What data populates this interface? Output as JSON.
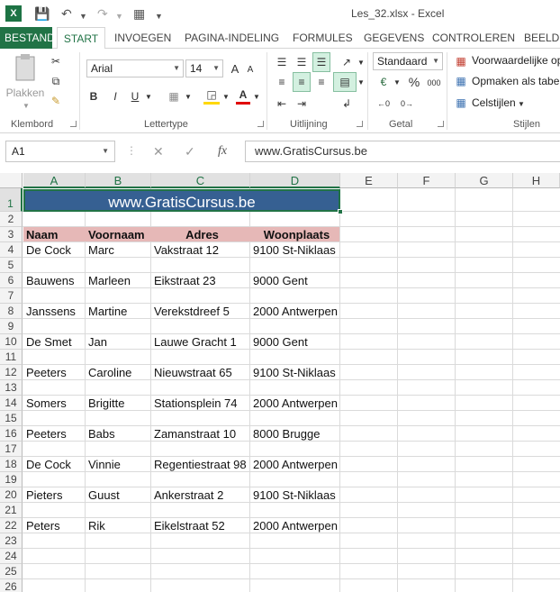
{
  "window": {
    "title": "Les_32.xlsx - Excel"
  },
  "tabs": [
    "BESTAND",
    "START",
    "INVOEGEN",
    "PAGINA-INDELING",
    "FORMULES",
    "GEGEVENS",
    "CONTROLEREN",
    "BEELD"
  ],
  "ribbon": {
    "clipboard": {
      "paste_label": "Plakken",
      "group": "Klembord"
    },
    "font": {
      "name": "Arial",
      "size": "14",
      "group": "Lettertype",
      "bold": "B",
      "italic": "I",
      "underline": "U",
      "grow": "A",
      "shrink": "A"
    },
    "alignment": {
      "group": "Uitlijning"
    },
    "number": {
      "format": "Standaard",
      "group": "Getal",
      "percent": "%",
      "thousands": "000"
    },
    "styles": {
      "conditional": "Voorwaardelijke op",
      "table": "Opmaken als tabel",
      "cell_styles": "Celstijlen",
      "group": "Stijlen"
    }
  },
  "formula_bar": {
    "name_box": "A1",
    "fx": "fx",
    "content": "www.GratisCursus.be"
  },
  "columns": [
    "A",
    "B",
    "C",
    "D",
    "E",
    "F",
    "G",
    "H"
  ],
  "rows": [
    "1",
    "2",
    "3",
    "4",
    "5",
    "6",
    "7",
    "8",
    "9",
    "10",
    "11",
    "12",
    "13",
    "14",
    "15",
    "16",
    "17",
    "18",
    "19",
    "20",
    "21",
    "22",
    "23",
    "24",
    "25",
    "26"
  ],
  "sheet": {
    "banner": "www.GratisCursus.be",
    "headers": [
      "Naam",
      "Voornaam",
      "Adres",
      "Woonplaats"
    ],
    "records": [
      {
        "row": 4,
        "naam": "De Cock",
        "voornaam": "Marc",
        "adres": "Vakstraat 12",
        "woonplaats": "9100 St-Niklaas"
      },
      {
        "row": 6,
        "naam": "Bauwens",
        "voornaam": "Marleen",
        "adres": "Eikstraat 23",
        "woonplaats": "9000 Gent"
      },
      {
        "row": 8,
        "naam": "Janssens",
        "voornaam": "Martine",
        "adres": "Verekstdreef 5",
        "woonplaats": "2000 Antwerpen"
      },
      {
        "row": 10,
        "naam": "De Smet",
        "voornaam": "Jan",
        "adres": "Lauwe Gracht 1",
        "woonplaats": "9000 Gent"
      },
      {
        "row": 12,
        "naam": "Peeters",
        "voornaam": "Caroline",
        "adres": "Nieuwstraat 65",
        "woonplaats": "9100 St-Niklaas"
      },
      {
        "row": 14,
        "naam": "Somers",
        "voornaam": "Brigitte",
        "adres": "Stationsplein 74",
        "woonplaats": "2000 Antwerpen"
      },
      {
        "row": 16,
        "naam": "Peeters",
        "voornaam": "Babs",
        "adres": "Zamanstraat 10",
        "woonplaats": "8000 Brugge"
      },
      {
        "row": 18,
        "naam": "De Cock",
        "voornaam": "Vinnie",
        "adres": "Regentiestraat 98",
        "woonplaats": "2000 Antwerpen"
      },
      {
        "row": 20,
        "naam": "Pieters",
        "voornaam": "Guust",
        "adres": "Ankerstraat 2",
        "woonplaats": "9100 St-Niklaas"
      },
      {
        "row": 22,
        "naam": "Peters",
        "voornaam": "Rik",
        "adres": "Eikelstraat 52",
        "woonplaats": "2000 Antwerpen"
      }
    ]
  },
  "colors": {
    "excel_green": "#217346",
    "banner_fill": "#366092",
    "header_fill": "#e6b8b7"
  }
}
